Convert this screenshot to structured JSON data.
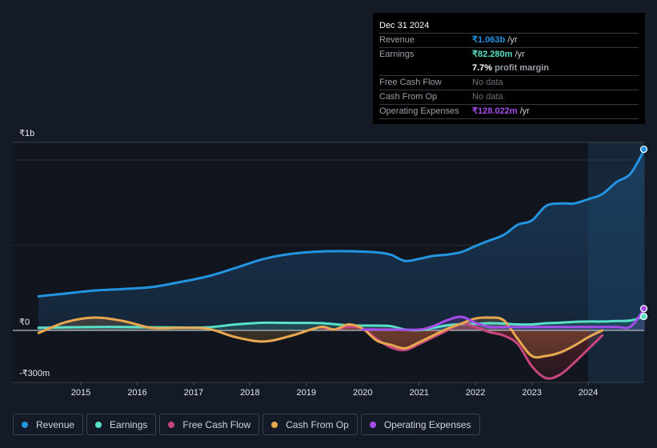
{
  "tooltip": {
    "date": "Dec 31 2024",
    "rows": [
      {
        "label": "Revenue",
        "value": "₹1.063b",
        "unit": " /yr",
        "color": "#2394df"
      },
      {
        "label": "Earnings",
        "value": "₹82.280m",
        "unit": " /yr",
        "color": "#59e0c8"
      },
      {
        "label": "",
        "value": "7.7%",
        "unit": " profit margin",
        "color": "#ffffff"
      },
      {
        "label": "Free Cash Flow",
        "value": "No data",
        "unit": "",
        "color": "#6b7078"
      },
      {
        "label": "Cash From Op",
        "value": "No data",
        "unit": "",
        "color": "#6b7078"
      },
      {
        "label": "Operating Expenses",
        "value": "₹128.022m",
        "unit": " /yr",
        "color": "#a54de8"
      }
    ]
  },
  "legend": [
    {
      "label": "Revenue",
      "color": "#2394df"
    },
    {
      "label": "Earnings",
      "color": "#59e0c8"
    },
    {
      "label": "Free Cash Flow",
      "color": "#c8467f"
    },
    {
      "label": "Cash From Op",
      "color": "#e8a850"
    },
    {
      "label": "Operating Expenses",
      "color": "#a54de8"
    }
  ],
  "chart_data": {
    "type": "line",
    "title": "",
    "xlabel": "",
    "ylabel": "",
    "y_tick_labels": [
      "₹1b",
      "₹0",
      "-₹300m"
    ],
    "x_tick_labels": [
      "2015",
      "2016",
      "2017",
      "2018",
      "2019",
      "2020",
      "2021",
      "2022",
      "2023",
      "2024"
    ],
    "ylim": [
      -305,
      1100
    ],
    "xlim": [
      2013.8,
      2025.0
    ],
    "units": "₹m",
    "highlight_region": [
      2024.0,
      2025.0
    ],
    "grid": true,
    "legend_position": "bottom",
    "series": [
      {
        "name": "Revenue",
        "color": "#2394df",
        "fill": true,
        "points": [
          [
            2014.25,
            200
          ],
          [
            2014.75,
            217
          ],
          [
            2015.25,
            234
          ],
          [
            2015.75,
            243
          ],
          [
            2016.25,
            254
          ],
          [
            2016.75,
            283
          ],
          [
            2017.25,
            317
          ],
          [
            2017.75,
            367
          ],
          [
            2018.25,
            420
          ],
          [
            2018.75,
            450
          ],
          [
            2019.25,
            463
          ],
          [
            2019.75,
            465
          ],
          [
            2020.25,
            458
          ],
          [
            2020.5,
            444
          ],
          [
            2020.75,
            408
          ],
          [
            2021.0,
            420
          ],
          [
            2021.25,
            437
          ],
          [
            2021.5,
            445
          ],
          [
            2021.75,
            460
          ],
          [
            2022.0,
            495
          ],
          [
            2022.25,
            528
          ],
          [
            2022.5,
            560
          ],
          [
            2022.75,
            620
          ],
          [
            2023.0,
            645
          ],
          [
            2023.25,
            730
          ],
          [
            2023.5,
            745
          ],
          [
            2023.75,
            745
          ],
          [
            2024.0,
            770
          ],
          [
            2024.25,
            800
          ],
          [
            2024.5,
            870
          ],
          [
            2024.75,
            920
          ],
          [
            2025.0,
            1063
          ]
        ]
      },
      {
        "name": "Earnings",
        "color": "#59e0c8",
        "fill": true,
        "points": [
          [
            2014.25,
            15
          ],
          [
            2014.75,
            18
          ],
          [
            2015.25,
            20
          ],
          [
            2015.75,
            20
          ],
          [
            2016.25,
            18
          ],
          [
            2016.75,
            17
          ],
          [
            2017.25,
            18
          ],
          [
            2017.75,
            35
          ],
          [
            2018.25,
            45
          ],
          [
            2018.75,
            44
          ],
          [
            2019.25,
            43
          ],
          [
            2019.75,
            30
          ],
          [
            2020.25,
            28
          ],
          [
            2020.5,
            25
          ],
          [
            2020.75,
            5
          ],
          [
            2021.0,
            2
          ],
          [
            2021.25,
            15
          ],
          [
            2021.5,
            30
          ],
          [
            2021.75,
            37
          ],
          [
            2022.0,
            38
          ],
          [
            2022.25,
            42
          ],
          [
            2022.5,
            40
          ],
          [
            2022.75,
            35
          ],
          [
            2023.0,
            35
          ],
          [
            2023.25,
            42
          ],
          [
            2023.5,
            45
          ],
          [
            2023.75,
            50
          ],
          [
            2024.0,
            52
          ],
          [
            2024.25,
            52
          ],
          [
            2024.5,
            55
          ],
          [
            2024.75,
            58
          ],
          [
            2025.0,
            82
          ]
        ]
      },
      {
        "name": "Free Cash Flow",
        "color": "#c8467f",
        "fill": true,
        "points": [
          [
            2019.25,
            20
          ],
          [
            2019.5,
            5
          ],
          [
            2019.75,
            20
          ],
          [
            2020.0,
            10
          ],
          [
            2020.25,
            -50
          ],
          [
            2020.5,
            -100
          ],
          [
            2020.75,
            -115
          ],
          [
            2021.0,
            -80
          ],
          [
            2021.25,
            -40
          ],
          [
            2021.5,
            0
          ],
          [
            2021.75,
            40
          ],
          [
            2022.0,
            20
          ],
          [
            2022.25,
            -10
          ],
          [
            2022.5,
            -30
          ],
          [
            2022.75,
            -80
          ],
          [
            2023.0,
            -210
          ],
          [
            2023.25,
            -280
          ],
          [
            2023.5,
            -260
          ],
          [
            2023.75,
            -190
          ],
          [
            2024.0,
            -110
          ],
          [
            2024.25,
            -30
          ]
        ]
      },
      {
        "name": "Cash From Op",
        "color": "#e8a850",
        "fill": true,
        "points": [
          [
            2014.25,
            -15
          ],
          [
            2014.75,
            50
          ],
          [
            2015.25,
            75
          ],
          [
            2015.75,
            55
          ],
          [
            2016.25,
            15
          ],
          [
            2016.75,
            15
          ],
          [
            2017.25,
            10
          ],
          [
            2017.75,
            -40
          ],
          [
            2018.25,
            -65
          ],
          [
            2018.75,
            -30
          ],
          [
            2019.25,
            20
          ],
          [
            2019.5,
            5
          ],
          [
            2019.75,
            35
          ],
          [
            2020.0,
            10
          ],
          [
            2020.25,
            -60
          ],
          [
            2020.5,
            -85
          ],
          [
            2020.75,
            -105
          ],
          [
            2021.0,
            -70
          ],
          [
            2021.25,
            -30
          ],
          [
            2021.5,
            10
          ],
          [
            2021.75,
            40
          ],
          [
            2022.0,
            70
          ],
          [
            2022.25,
            75
          ],
          [
            2022.5,
            60
          ],
          [
            2022.75,
            -50
          ],
          [
            2023.0,
            -150
          ],
          [
            2023.25,
            -150
          ],
          [
            2023.5,
            -130
          ],
          [
            2023.75,
            -90
          ],
          [
            2024.0,
            -40
          ],
          [
            2024.25,
            0
          ]
        ]
      },
      {
        "name": "Operating Expenses",
        "color": "#a54de8",
        "fill": true,
        "points": [
          [
            2020.0,
            5
          ],
          [
            2020.5,
            5
          ],
          [
            2021.0,
            5
          ],
          [
            2021.25,
            25
          ],
          [
            2021.5,
            60
          ],
          [
            2021.75,
            80
          ],
          [
            2022.0,
            45
          ],
          [
            2022.25,
            20
          ],
          [
            2022.5,
            20
          ],
          [
            2022.75,
            20
          ],
          [
            2023.0,
            20
          ],
          [
            2023.5,
            20
          ],
          [
            2024.0,
            20
          ],
          [
            2024.5,
            20
          ],
          [
            2024.75,
            22
          ],
          [
            2025.0,
            128
          ]
        ]
      }
    ]
  }
}
